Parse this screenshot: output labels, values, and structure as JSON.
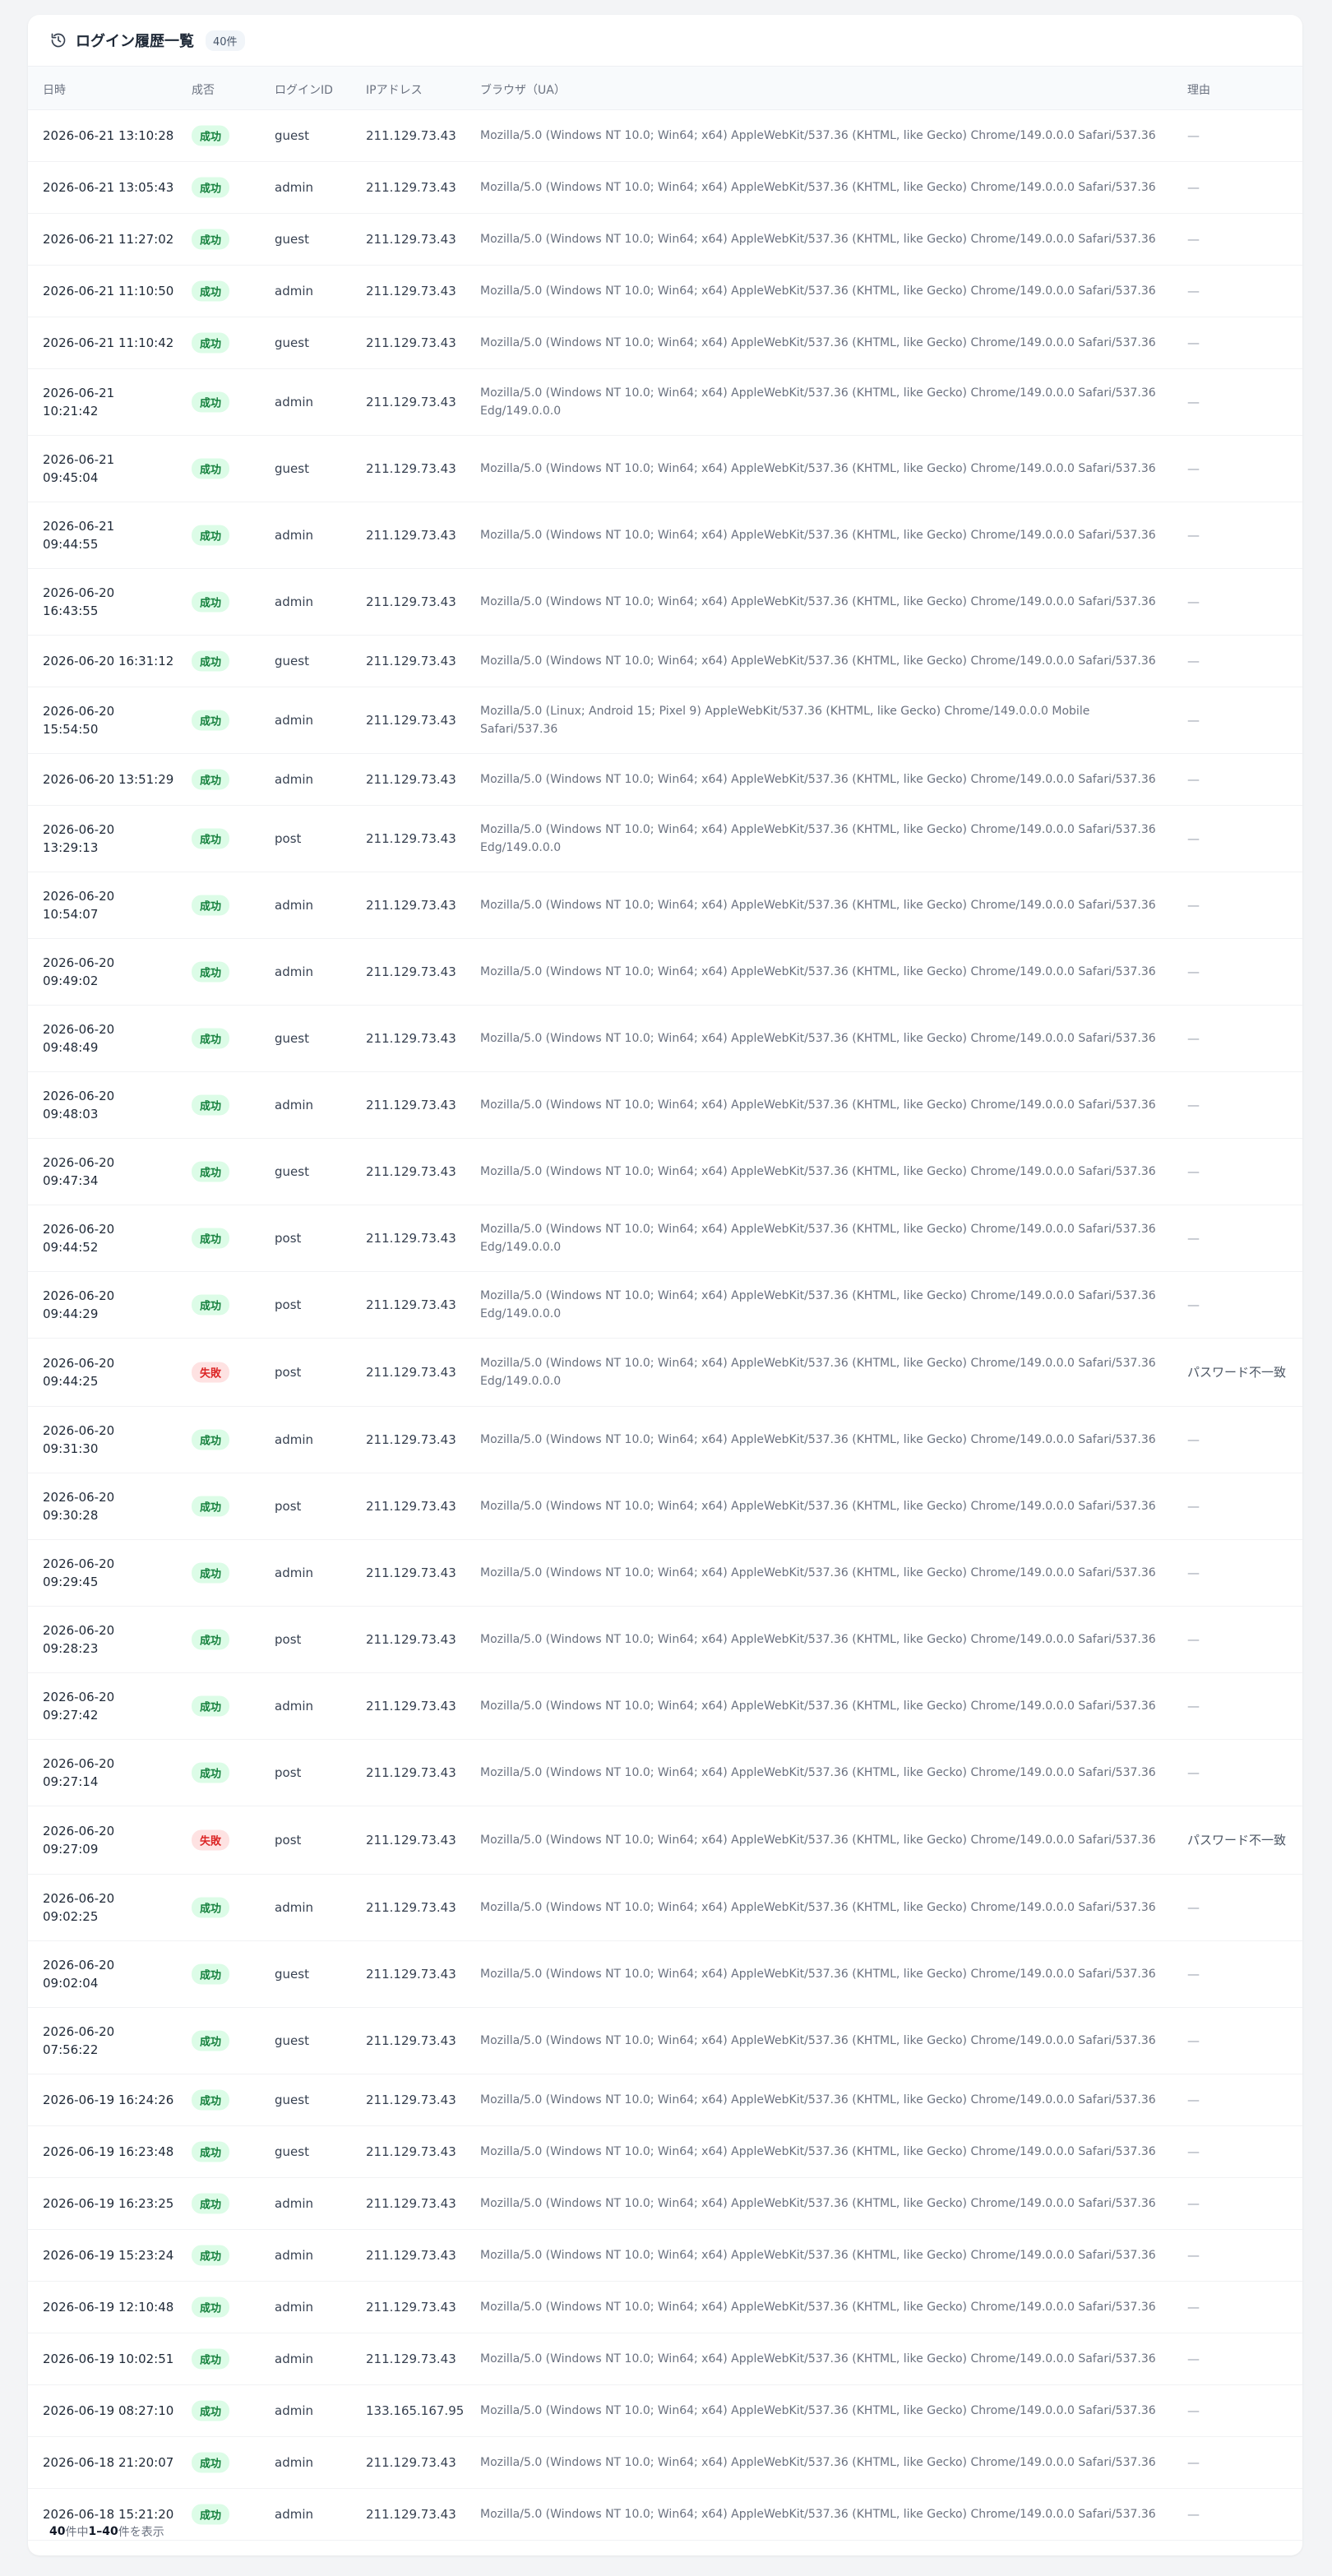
{
  "header": {
    "title": "ログイン履歴一覧",
    "count_badge": "40件",
    "icon": "history-icon"
  },
  "columns": [
    "日時",
    "成否",
    "ログインID",
    "IPアドレス",
    "ブラウザ（UA）",
    "理由"
  ],
  "badge_colors": {
    "success_bg": "#dcfce7",
    "success_fg": "#15803d",
    "fail_bg": "#fee2e2",
    "fail_fg": "#dc2626"
  },
  "rows": [
    {
      "date": "2026-06-21 13:10:28",
      "result": "成功",
      "status": "success",
      "login": "guest",
      "ip": "211.129.73.43",
      "ua": "Mozilla/5.0 (Windows NT 10.0; Win64; x64) AppleWebKit/537.36 (KHTML, like Gecko) Chrome/149.0.0.0 Safari/537.36",
      "reason": "—",
      "h": 62
    },
    {
      "date": "2026-06-21 13:05:43",
      "result": "成功",
      "status": "success",
      "login": "admin",
      "ip": "211.129.73.43",
      "ua": "Mozilla/5.0 (Windows NT 10.0; Win64; x64) AppleWebKit/537.36 (KHTML, like Gecko) Chrome/149.0.0.0 Safari/537.36",
      "reason": "—",
      "h": 62
    },
    {
      "date": "2026-06-21 11:27:02",
      "result": "成功",
      "status": "success",
      "login": "guest",
      "ip": "211.129.73.43",
      "ua": "Mozilla/5.0 (Windows NT 10.0; Win64; x64) AppleWebKit/537.36 (KHTML, like Gecko) Chrome/149.0.0.0 Safari/537.36",
      "reason": "—",
      "h": 62
    },
    {
      "date": "2026-06-21 11:10:50",
      "result": "成功",
      "status": "success",
      "login": "admin",
      "ip": "211.129.73.43",
      "ua": "Mozilla/5.0 (Windows NT 10.0; Win64; x64) AppleWebKit/537.36 (KHTML, like Gecko) Chrome/149.0.0.0 Safari/537.36",
      "reason": "—",
      "h": 62
    },
    {
      "date": "2026-06-21 11:10:42",
      "result": "成功",
      "status": "success",
      "login": "guest",
      "ip": "211.129.73.43",
      "ua": "Mozilla/5.0 (Windows NT 10.0; Win64; x64) AppleWebKit/537.36 (KHTML, like Gecko) Chrome/149.0.0.0 Safari/537.36",
      "reason": "—",
      "h": 62
    },
    {
      "date": "2026-06-21 10:21:42",
      "result": "成功",
      "status": "success",
      "login": "admin",
      "ip": "211.129.73.43",
      "ua": "Mozilla/5.0 (Windows NT 10.0; Win64; x64) AppleWebKit/537.36 (KHTML, like Gecko) Chrome/149.0.0.0 Safari/537.36 Edg/149.0.0.0",
      "reason": "—",
      "h": 80
    },
    {
      "date": "2026-06-21 09:45:04",
      "result": "成功",
      "status": "success",
      "login": "guest",
      "ip": "211.129.73.43",
      "ua": "Mozilla/5.0 (Windows NT 10.0; Win64; x64) AppleWebKit/537.36 (KHTML, like Gecko) Chrome/149.0.0.0 Safari/537.36",
      "reason": "—",
      "h": 80
    },
    {
      "date": "2026-06-21 09:44:55",
      "result": "成功",
      "status": "success",
      "login": "admin",
      "ip": "211.129.73.43",
      "ua": "Mozilla/5.0 (Windows NT 10.0; Win64; x64) AppleWebKit/537.36 (KHTML, like Gecko) Chrome/149.0.0.0 Safari/537.36",
      "reason": "—",
      "h": 80
    },
    {
      "date": "2026-06-20 16:43:55",
      "result": "成功",
      "status": "success",
      "login": "admin",
      "ip": "211.129.73.43",
      "ua": "Mozilla/5.0 (Windows NT 10.0; Win64; x64) AppleWebKit/537.36 (KHTML, like Gecko) Chrome/149.0.0.0 Safari/537.36",
      "reason": "—",
      "h": 80
    },
    {
      "date": "2026-06-20 16:31:12",
      "result": "成功",
      "status": "success",
      "login": "guest",
      "ip": "211.129.73.43",
      "ua": "Mozilla/5.0 (Windows NT 10.0; Win64; x64) AppleWebKit/537.36 (KHTML, like Gecko) Chrome/149.0.0.0 Safari/537.36",
      "reason": "—",
      "h": 62
    },
    {
      "date": "2026-06-20 15:54:50",
      "result": "成功",
      "status": "success",
      "login": "admin",
      "ip": "211.129.73.43",
      "ua": "Mozilla/5.0 (Linux; Android 15; Pixel 9) AppleWebKit/537.36 (KHTML, like Gecko) Chrome/149.0.0.0 Mobile Safari/537.36",
      "reason": "—",
      "h": 80
    },
    {
      "date": "2026-06-20 13:51:29",
      "result": "成功",
      "status": "success",
      "login": "admin",
      "ip": "211.129.73.43",
      "ua": "Mozilla/5.0 (Windows NT 10.0; Win64; x64) AppleWebKit/537.36 (KHTML, like Gecko) Chrome/149.0.0.0 Safari/537.36",
      "reason": "—",
      "h": 62
    },
    {
      "date": "2026-06-20 13:29:13",
      "result": "成功",
      "status": "success",
      "login": "post",
      "ip": "211.129.73.43",
      "ua": "Mozilla/5.0 (Windows NT 10.0; Win64; x64) AppleWebKit/537.36 (KHTML, like Gecko) Chrome/149.0.0.0 Safari/537.36 Edg/149.0.0.0",
      "reason": "—",
      "h": 80
    },
    {
      "date": "2026-06-20 10:54:07",
      "result": "成功",
      "status": "success",
      "login": "admin",
      "ip": "211.129.73.43",
      "ua": "Mozilla/5.0 (Windows NT 10.0; Win64; x64) AppleWebKit/537.36 (KHTML, like Gecko) Chrome/149.0.0.0 Safari/537.36",
      "reason": "—",
      "h": 80
    },
    {
      "date": "2026-06-20 09:49:02",
      "result": "成功",
      "status": "success",
      "login": "admin",
      "ip": "211.129.73.43",
      "ua": "Mozilla/5.0 (Windows NT 10.0; Win64; x64) AppleWebKit/537.36 (KHTML, like Gecko) Chrome/149.0.0.0 Safari/537.36",
      "reason": "—",
      "h": 80
    },
    {
      "date": "2026-06-20 09:48:49",
      "result": "成功",
      "status": "success",
      "login": "guest",
      "ip": "211.129.73.43",
      "ua": "Mozilla/5.0 (Windows NT 10.0; Win64; x64) AppleWebKit/537.36 (KHTML, like Gecko) Chrome/149.0.0.0 Safari/537.36",
      "reason": "—",
      "h": 80
    },
    {
      "date": "2026-06-20 09:48:03",
      "result": "成功",
      "status": "success",
      "login": "admin",
      "ip": "211.129.73.43",
      "ua": "Mozilla/5.0 (Windows NT 10.0; Win64; x64) AppleWebKit/537.36 (KHTML, like Gecko) Chrome/149.0.0.0 Safari/537.36",
      "reason": "—",
      "h": 80
    },
    {
      "date": "2026-06-20 09:47:34",
      "result": "成功",
      "status": "success",
      "login": "guest",
      "ip": "211.129.73.43",
      "ua": "Mozilla/5.0 (Windows NT 10.0; Win64; x64) AppleWebKit/537.36 (KHTML, like Gecko) Chrome/149.0.0.0 Safari/537.36",
      "reason": "—",
      "h": 80
    },
    {
      "date": "2026-06-20 09:44:52",
      "result": "成功",
      "status": "success",
      "login": "post",
      "ip": "211.129.73.43",
      "ua": "Mozilla/5.0 (Windows NT 10.0; Win64; x64) AppleWebKit/537.36 (KHTML, like Gecko) Chrome/149.0.0.0 Safari/537.36 Edg/149.0.0.0",
      "reason": "—",
      "h": 80
    },
    {
      "date": "2026-06-20 09:44:29",
      "result": "成功",
      "status": "success",
      "login": "post",
      "ip": "211.129.73.43",
      "ua": "Mozilla/5.0 (Windows NT 10.0; Win64; x64) AppleWebKit/537.36 (KHTML, like Gecko) Chrome/149.0.0.0 Safari/537.36 Edg/149.0.0.0",
      "reason": "—",
      "h": 80
    },
    {
      "date": "2026-06-20 09:44:25",
      "result": "失敗",
      "status": "fail",
      "login": "post",
      "ip": "211.129.73.43",
      "ua": "Mozilla/5.0 (Windows NT 10.0; Win64; x64) AppleWebKit/537.36 (KHTML, like Gecko) Chrome/149.0.0.0 Safari/537.36 Edg/149.0.0.0",
      "reason": "パスワード不一致",
      "h": 82
    },
    {
      "date": "2026-06-20 09:31:30",
      "result": "成功",
      "status": "success",
      "login": "admin",
      "ip": "211.129.73.43",
      "ua": "Mozilla/5.0 (Windows NT 10.0; Win64; x64) AppleWebKit/537.36 (KHTML, like Gecko) Chrome/149.0.0.0 Safari/537.36",
      "reason": "—",
      "h": 80
    },
    {
      "date": "2026-06-20 09:30:28",
      "result": "成功",
      "status": "success",
      "login": "post",
      "ip": "211.129.73.43",
      "ua": "Mozilla/5.0 (Windows NT 10.0; Win64; x64) AppleWebKit/537.36 (KHTML, like Gecko) Chrome/149.0.0.0 Safari/537.36",
      "reason": "—",
      "h": 80
    },
    {
      "date": "2026-06-20 09:29:45",
      "result": "成功",
      "status": "success",
      "login": "admin",
      "ip": "211.129.73.43",
      "ua": "Mozilla/5.0 (Windows NT 10.0; Win64; x64) AppleWebKit/537.36 (KHTML, like Gecko) Chrome/149.0.0.0 Safari/537.36",
      "reason": "—",
      "h": 80
    },
    {
      "date": "2026-06-20 09:28:23",
      "result": "成功",
      "status": "success",
      "login": "post",
      "ip": "211.129.73.43",
      "ua": "Mozilla/5.0 (Windows NT 10.0; Win64; x64) AppleWebKit/537.36 (KHTML, like Gecko) Chrome/149.0.0.0 Safari/537.36",
      "reason": "—",
      "h": 80
    },
    {
      "date": "2026-06-20 09:27:42",
      "result": "成功",
      "status": "success",
      "login": "admin",
      "ip": "211.129.73.43",
      "ua": "Mozilla/5.0 (Windows NT 10.0; Win64; x64) AppleWebKit/537.36 (KHTML, like Gecko) Chrome/149.0.0.0 Safari/537.36",
      "reason": "—",
      "h": 80
    },
    {
      "date": "2026-06-20 09:27:14",
      "result": "成功",
      "status": "success",
      "login": "post",
      "ip": "211.129.73.43",
      "ua": "Mozilla/5.0 (Windows NT 10.0; Win64; x64) AppleWebKit/537.36 (KHTML, like Gecko) Chrome/149.0.0.0 Safari/537.36",
      "reason": "—",
      "h": 80
    },
    {
      "date": "2026-06-20 09:27:09",
      "result": "失敗",
      "status": "fail",
      "login": "post",
      "ip": "211.129.73.43",
      "ua": "Mozilla/5.0 (Windows NT 10.0; Win64; x64) AppleWebKit/537.36 (KHTML, like Gecko) Chrome/149.0.0.0 Safari/537.36",
      "reason": "パスワード不一致",
      "h": 82
    },
    {
      "date": "2026-06-20 09:02:25",
      "result": "成功",
      "status": "success",
      "login": "admin",
      "ip": "211.129.73.43",
      "ua": "Mozilla/5.0 (Windows NT 10.0; Win64; x64) AppleWebKit/537.36 (KHTML, like Gecko) Chrome/149.0.0.0 Safari/537.36",
      "reason": "—",
      "h": 80
    },
    {
      "date": "2026-06-20 09:02:04",
      "result": "成功",
      "status": "success",
      "login": "guest",
      "ip": "211.129.73.43",
      "ua": "Mozilla/5.0 (Windows NT 10.0; Win64; x64) AppleWebKit/537.36 (KHTML, like Gecko) Chrome/149.0.0.0 Safari/537.36",
      "reason": "—",
      "h": 80
    },
    {
      "date": "2026-06-20 07:56:22",
      "result": "成功",
      "status": "success",
      "login": "guest",
      "ip": "211.129.73.43",
      "ua": "Mozilla/5.0 (Windows NT 10.0; Win64; x64) AppleWebKit/537.36 (KHTML, like Gecko) Chrome/149.0.0.0 Safari/537.36",
      "reason": "—",
      "h": 80
    },
    {
      "date": "2026-06-19 16:24:26",
      "result": "成功",
      "status": "success",
      "login": "guest",
      "ip": "211.129.73.43",
      "ua": "Mozilla/5.0 (Windows NT 10.0; Win64; x64) AppleWebKit/537.36 (KHTML, like Gecko) Chrome/149.0.0.0 Safari/537.36",
      "reason": "—",
      "h": 62
    },
    {
      "date": "2026-06-19 16:23:48",
      "result": "成功",
      "status": "success",
      "login": "guest",
      "ip": "211.129.73.43",
      "ua": "Mozilla/5.0 (Windows NT 10.0; Win64; x64) AppleWebKit/537.36 (KHTML, like Gecko) Chrome/149.0.0.0 Safari/537.36",
      "reason": "—",
      "h": 62
    },
    {
      "date": "2026-06-19 16:23:25",
      "result": "成功",
      "status": "success",
      "login": "admin",
      "ip": "211.129.73.43",
      "ua": "Mozilla/5.0 (Windows NT 10.0; Win64; x64) AppleWebKit/537.36 (KHTML, like Gecko) Chrome/149.0.0.0 Safari/537.36",
      "reason": "—",
      "h": 62
    },
    {
      "date": "2026-06-19 15:23:24",
      "result": "成功",
      "status": "success",
      "login": "admin",
      "ip": "211.129.73.43",
      "ua": "Mozilla/5.0 (Windows NT 10.0; Win64; x64) AppleWebKit/537.36 (KHTML, like Gecko) Chrome/149.0.0.0 Safari/537.36",
      "reason": "—",
      "h": 62
    },
    {
      "date": "2026-06-19 12:10:48",
      "result": "成功",
      "status": "success",
      "login": "admin",
      "ip": "211.129.73.43",
      "ua": "Mozilla/5.0 (Windows NT 10.0; Win64; x64) AppleWebKit/537.36 (KHTML, like Gecko) Chrome/149.0.0.0 Safari/537.36",
      "reason": "—",
      "h": 62
    },
    {
      "date": "2026-06-19 10:02:51",
      "result": "成功",
      "status": "success",
      "login": "admin",
      "ip": "211.129.73.43",
      "ua": "Mozilla/5.0 (Windows NT 10.0; Win64; x64) AppleWebKit/537.36 (KHTML, like Gecko) Chrome/149.0.0.0 Safari/537.36",
      "reason": "—",
      "h": 62
    },
    {
      "date": "2026-06-19 08:27:10",
      "result": "成功",
      "status": "success",
      "login": "admin",
      "ip": "133.165.167.95",
      "ua": "Mozilla/5.0 (Windows NT 10.0; Win64; x64) AppleWebKit/537.36 (KHTML, like Gecko) Chrome/149.0.0.0 Safari/537.36",
      "reason": "—",
      "h": 62
    },
    {
      "date": "2026-06-18 21:20:07",
      "result": "成功",
      "status": "success",
      "login": "admin",
      "ip": "211.129.73.43",
      "ua": "Mozilla/5.0 (Windows NT 10.0; Win64; x64) AppleWebKit/537.36 (KHTML, like Gecko) Chrome/149.0.0.0 Safari/537.36",
      "reason": "—",
      "h": 62
    },
    {
      "date": "2026-06-18 15:21:20",
      "result": "成功",
      "status": "success",
      "login": "admin",
      "ip": "211.129.73.43",
      "ua": "Mozilla/5.0 (Windows NT 10.0; Win64; x64) AppleWebKit/537.36 (KHTML, like Gecko) Chrome/149.0.0.0 Safari/537.36",
      "reason": "—",
      "h": 62
    }
  ],
  "footer": {
    "total": "40",
    "total_suffix": "件中 ",
    "range": "1–40",
    "range_suffix": "件を表示"
  }
}
